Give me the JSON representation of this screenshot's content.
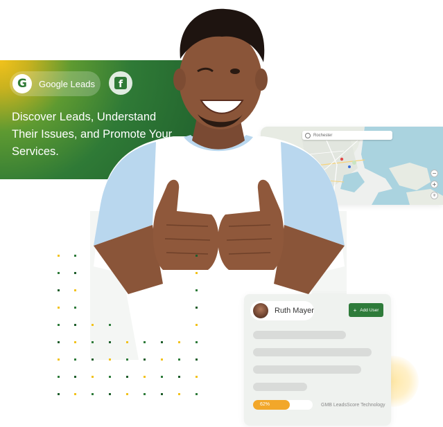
{
  "promo": {
    "google_label": "Google Leads",
    "headline": "Discover Leads, Understand Their Issues, and Promote Your Services."
  },
  "map": {
    "search_placeholder": "Rochester",
    "zoom_in": "+",
    "zoom_out": "−"
  },
  "user_card": {
    "name": "Ruth Mayer",
    "add_button": "Add User",
    "progress_text": "62%",
    "progress_value": 0.62,
    "technology_text": "GMB LeadsScore Technology"
  },
  "colors": {
    "brand_green": "#2e7b3a",
    "accent_yellow": "#f2c21b",
    "progress_orange": "#f2a72a"
  }
}
